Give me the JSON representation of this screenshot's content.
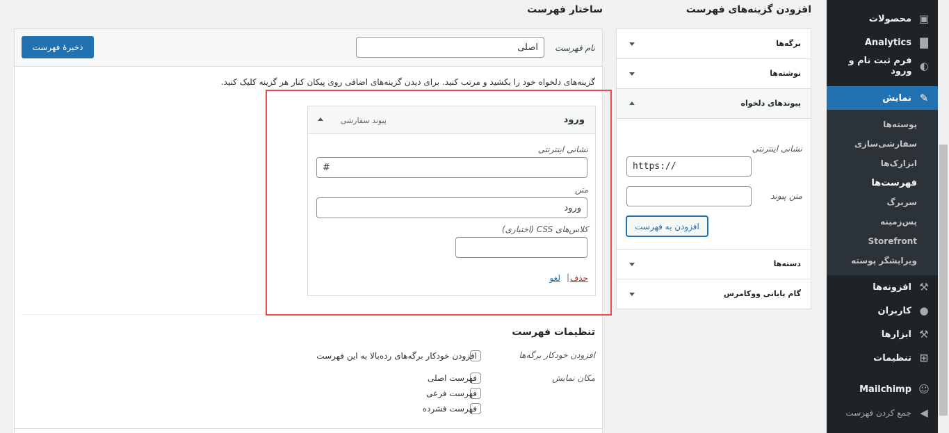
{
  "sidebar": {
    "items": [
      {
        "label": "محصولات",
        "icon": "box-icon"
      },
      {
        "label": "Analytics",
        "icon": "bar-chart-icon"
      },
      {
        "label": "فرم ثبت نام و ورود",
        "icon": "form-icon"
      },
      {
        "label": "نمایش",
        "icon": "paintbrush-icon"
      },
      {
        "label": "افزونه‌ها",
        "icon": "plugin-icon"
      },
      {
        "label": "کاربران",
        "icon": "user-icon"
      },
      {
        "label": "ابزارها",
        "icon": "wrench-icon"
      },
      {
        "label": "تنظیمات",
        "icon": "settings-icon"
      },
      {
        "label": "Mailchimp",
        "icon": "mailchimp-icon"
      },
      {
        "label": "جمع کردن فهرست",
        "icon": "collapse-icon"
      }
    ],
    "submenu": [
      "پوسته‌ها",
      "سفارشی‌سازی",
      "ابزارک‌ها",
      "فهرست‌ها",
      "سربرگ",
      "پس‌زمینه",
      "Storefront",
      "ویرایشگر پوسته"
    ]
  },
  "add_items": {
    "heading": "افزودن گزینه‌های فهرست",
    "sections": [
      "برگه‌ها",
      "نوشته‌ها",
      "پیوندهای دلخواه",
      "دسته‌ها",
      "گام پایانی ووکامرس"
    ],
    "custom_link": {
      "url_label": "نشانی اینترنتی",
      "url_value": "https://",
      "text_label": "متن پیوند",
      "text_value": "",
      "button": "افزودن به فهرست"
    }
  },
  "structure": {
    "heading": "ساختار فهرست",
    "menu_name_label": "نام فهرست",
    "menu_name_value": "اصلی",
    "save_button": "ذخیرهٔ فهرست",
    "instructions": "گزینه‌های دلخواه خود را بکشید و مرتب کنید. برای دیدن گزینه‌های اضافی روی پیکان کنار هر گزینه کلیک کنید.",
    "item": {
      "title": "ورود",
      "type": "پیوند سفارشی",
      "url_label": "نشانی اینترنتی",
      "url_value": "#",
      "text_label": "متن",
      "text_value": "ورود",
      "css_label": "کلاس‌های CSS (اختیاری)",
      "css_value": "",
      "delete": "حذف",
      "separator": "|",
      "cancel": "لغو"
    },
    "settings": {
      "heading": "تنظیمات فهرست",
      "auto_add_label": "افزودن خودکار برگه‌ها",
      "auto_add_option": "افزودن خودکار برگه‌های رده‌بالا به این فهرست",
      "location_label": "مکان نمایش",
      "locations": [
        "فهرست اصلی",
        "فهرست فرعی",
        "فهرست فشرده"
      ]
    }
  },
  "colors": {
    "admin_bar": "#1d2327",
    "accent": "#2271b1",
    "highlight": "#e64d4d",
    "delete": "#b32d2e"
  }
}
